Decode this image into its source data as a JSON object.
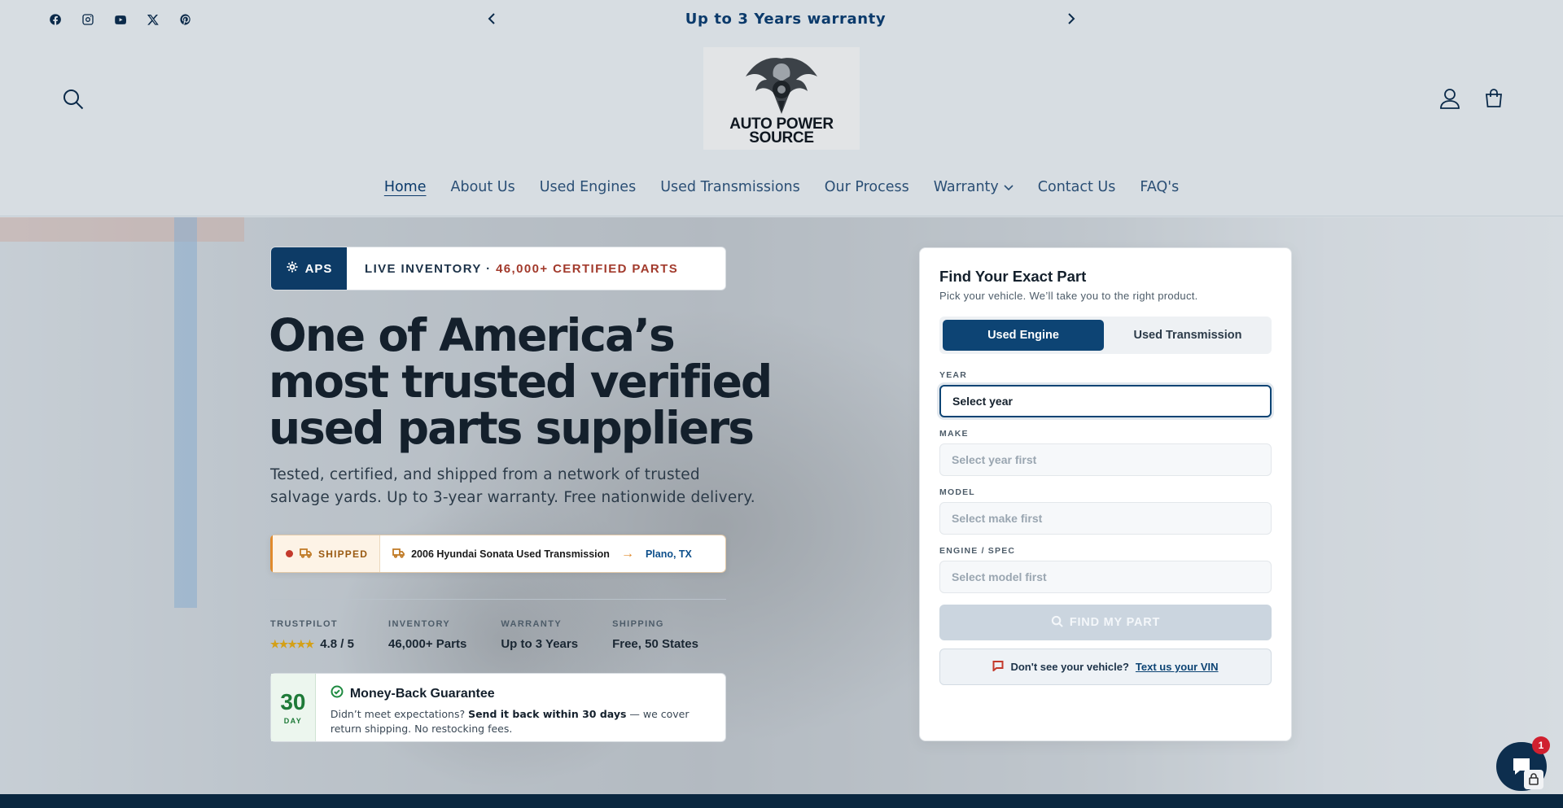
{
  "announcement": {
    "text": "Up to 3 Years warranty"
  },
  "socials": [
    "facebook-icon",
    "instagram-icon",
    "youtube-icon",
    "x-icon",
    "pinterest-icon"
  ],
  "logo": {
    "line1": "AUTO POWER",
    "line2": "SOURCE"
  },
  "nav": [
    {
      "label": "Home",
      "active": true
    },
    {
      "label": "About Us"
    },
    {
      "label": "Used Engines"
    },
    {
      "label": "Used Transmissions"
    },
    {
      "label": "Our Process"
    },
    {
      "label": "Warranty",
      "dropdown": true
    },
    {
      "label": "Contact Us"
    },
    {
      "label": "FAQ's"
    }
  ],
  "hero": {
    "badge_brand": "APS",
    "badge_text_prefix": "LIVE INVENTORY · ",
    "badge_text_highlight": "46,000+ CERTIFIED PARTS",
    "headline": "One of America’s most trusted verified used parts suppliers",
    "subhead": "Tested, certified, and shipped from a network of trusted salvage yards. Up to 3-year warranty. Free nationwide delivery.",
    "shipped": {
      "tag": "SHIPPED",
      "item": "2006 Hyundai Sonata Used Transmission",
      "arrow": "→",
      "location": "Plano, TX"
    },
    "stats": [
      {
        "label": "TRUSTPILOT",
        "value": "4.8 / 5",
        "stars": "★★★★★"
      },
      {
        "label": "INVENTORY",
        "value": "46,000+ Parts"
      },
      {
        "label": "WARRANTY",
        "value": "Up to 3 Years"
      },
      {
        "label": "SHIPPING",
        "value": "Free, 50 States"
      }
    ],
    "guarantee": {
      "days": "30",
      "unit": "DAY",
      "title": "Money-Back Guarantee",
      "desc_prefix": "Didn’t meet expectations? ",
      "desc_bold": "Send it back within 30 days",
      "desc_suffix": " — we cover return shipping. No restocking fees."
    }
  },
  "finder": {
    "title": "Find Your Exact Part",
    "subtitle": "Pick your vehicle. We’ll take you to the right product.",
    "tabs": [
      {
        "label": "Used Engine",
        "active": true
      },
      {
        "label": "Used Transmission"
      }
    ],
    "fields": [
      {
        "label": "YEAR",
        "value": "Select year",
        "active": true
      },
      {
        "label": "MAKE",
        "value": "Select year first"
      },
      {
        "label": "MODEL",
        "value": "Select make first"
      },
      {
        "label": "ENGINE / SPEC",
        "value": "Select model first"
      }
    ],
    "button": "FIND MY PART",
    "vin_prompt": "Don't see your vehicle?",
    "vin_link": "Text us your VIN"
  },
  "chat": {
    "badge": "1"
  },
  "colors": {
    "primary": "#0d4474",
    "accent": "#e08a2c",
    "alert": "#c43a2c",
    "success": "#1e7a38"
  }
}
